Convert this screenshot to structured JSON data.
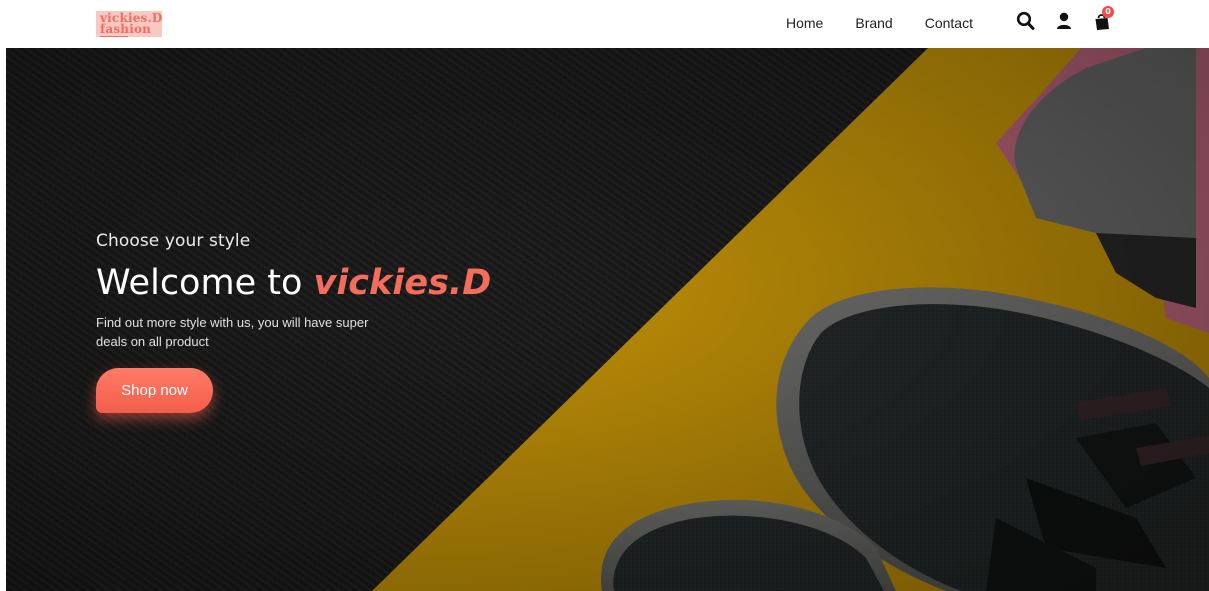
{
  "brand": {
    "logo_line1": "vickies.D",
    "logo_line2": "fashion"
  },
  "nav": {
    "links": [
      "Home",
      "Brand",
      "Contact"
    ]
  },
  "icons": {
    "search": "search-icon",
    "user": "user-icon",
    "cart": "shopping-bag-icon",
    "cart_count": "0"
  },
  "hero": {
    "kicker": "Choose your style",
    "title_prefix": "Welcome to ",
    "title_brand": "vickies.D",
    "description": "Find out more style with us, you will have super deals on all product",
    "cta_label": "Shop now"
  },
  "colors": {
    "accent": "#f26d5b",
    "hero_dark": "#1c1c1c",
    "hero_yellow": "#d9a80b",
    "badge": "#f44a4a"
  }
}
